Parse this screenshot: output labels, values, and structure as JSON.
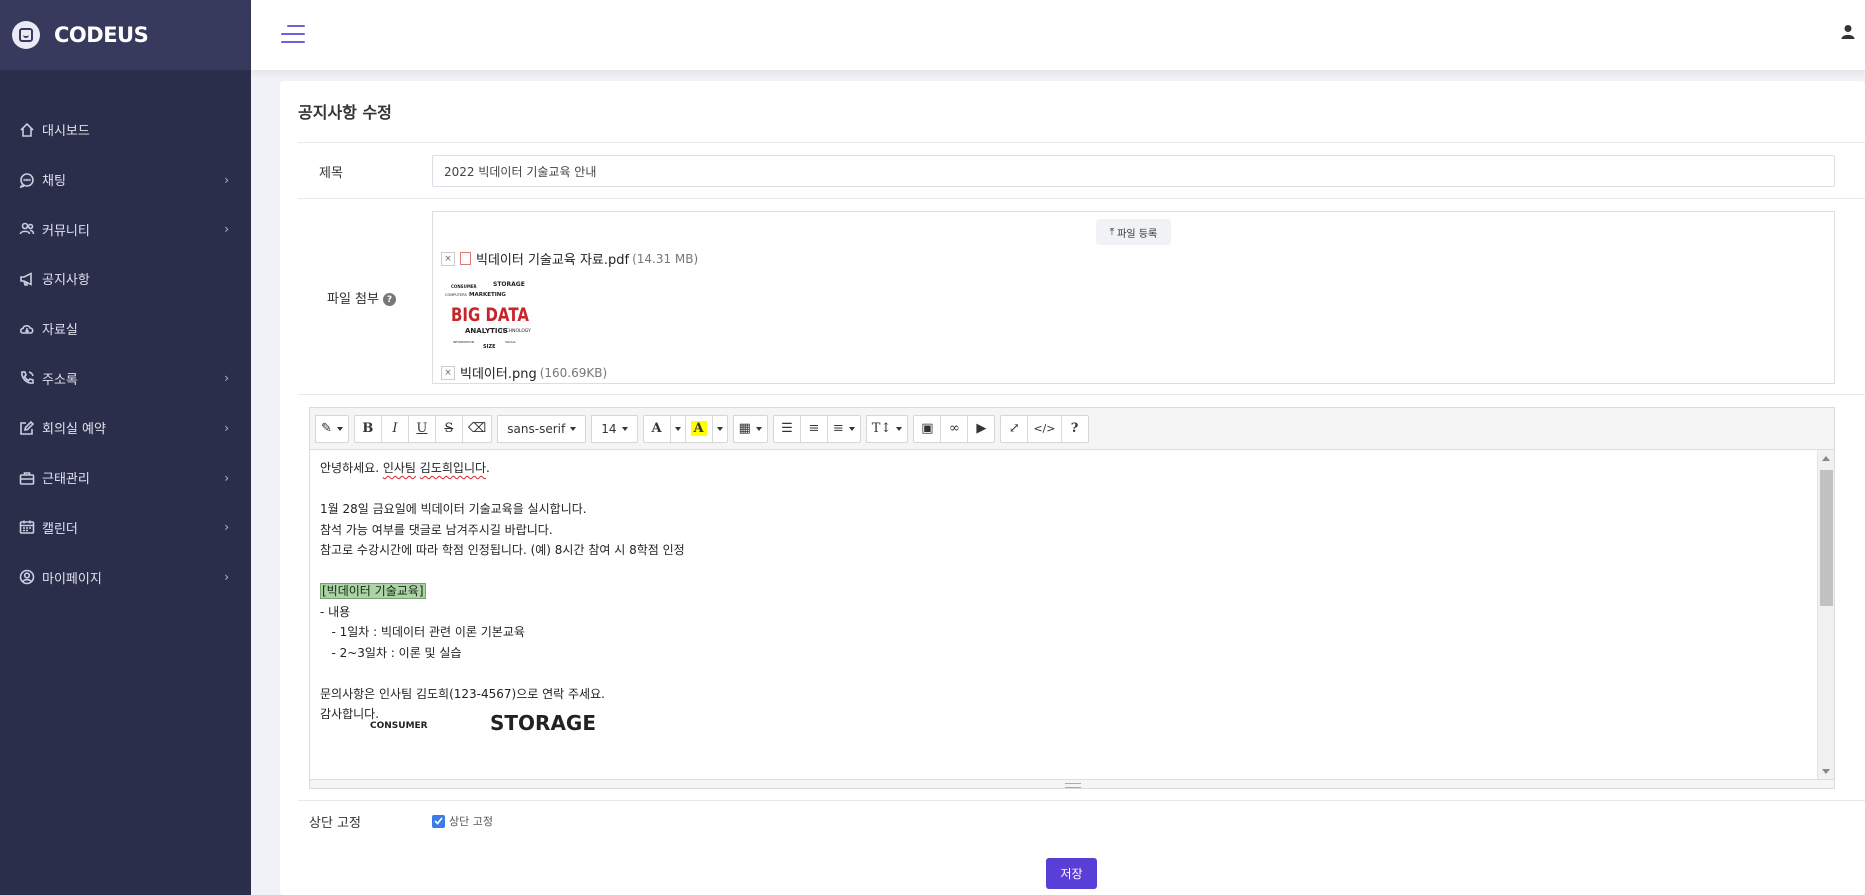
{
  "brand": {
    "name": "CODEUS"
  },
  "sidebar": {
    "items": [
      {
        "label": "대시보드",
        "icon": "home-icon",
        "has_children": false
      },
      {
        "label": "채팅",
        "icon": "chat-icon",
        "has_children": true
      },
      {
        "label": "커뮤니티",
        "icon": "users-icon",
        "has_children": true
      },
      {
        "label": "공지사항",
        "icon": "megaphone-icon",
        "has_children": false
      },
      {
        "label": "자료실",
        "icon": "cloud-download-icon",
        "has_children": false
      },
      {
        "label": "주소록",
        "icon": "phone-icon",
        "has_children": true
      },
      {
        "label": "회의실 예약",
        "icon": "edit-icon",
        "has_children": true
      },
      {
        "label": "근태관리",
        "icon": "briefcase-icon",
        "has_children": true
      },
      {
        "label": "캘린더",
        "icon": "calendar-icon",
        "has_children": true
      },
      {
        "label": "마이페이지",
        "icon": "user-circle-icon",
        "has_children": true
      }
    ],
    "chevron": "›"
  },
  "page": {
    "title": "공지사항 수정",
    "subject_label": "제목",
    "subject_value": "2022 빅데이터 기술교육 안내",
    "attach_label": "파일 첨부",
    "help_glyph": "?",
    "upload_label": "파일 등록",
    "files": [
      {
        "name": "빅데이터 기술교육 자료.pdf",
        "size": "(14.31 MB)"
      },
      {
        "name": "빅데이터.png",
        "size": "(160.69KB)"
      }
    ],
    "remove_glyph": "×",
    "pin_label": "상단 고정",
    "pin_check_label": "상단 고정",
    "pin_checked": true,
    "save_label": "저장"
  },
  "editor": {
    "font_name": "sans-serif",
    "font_size": "14",
    "lines": [
      "안녕하세요. 인사팀 김도희입니다.",
      "",
      "1월 28일 금요일에 빅데이터 기술교육을 실시합니다.",
      "참석 가능 여부를 댓글로 남겨주시길 바랍니다.",
      "참고로 수강시간에 따라 학점 인정됩니다. (예) 8시간 참여 시 8학점 인정",
      "",
      "[빅데이터 기술교육]",
      "- 내용",
      "   - 1일차 : 빅데이터 관련 이론 기본교육",
      "   - 2~3일차 : 이론 및 실습",
      "",
      "문의사항은 인사팀 김도희(123-4567)으로 연락 주세요.",
      "감사합니다."
    ],
    "image_words": [
      "CONSUMER",
      "STORAGE"
    ]
  },
  "thumbnail": {
    "words": [
      "CONSUMER",
      "STORAGE",
      "MARKETING",
      "COMPUTERS",
      "BIG DATA",
      "ANALYTICS",
      "TECHNOLOGY",
      "SIZE",
      "INFORMATION",
      "SOCIAL"
    ]
  },
  "colors": {
    "sidebar_bg": "#2b2e4a",
    "accent": "#5a3fd6",
    "highlight": "#a8d5a2"
  }
}
